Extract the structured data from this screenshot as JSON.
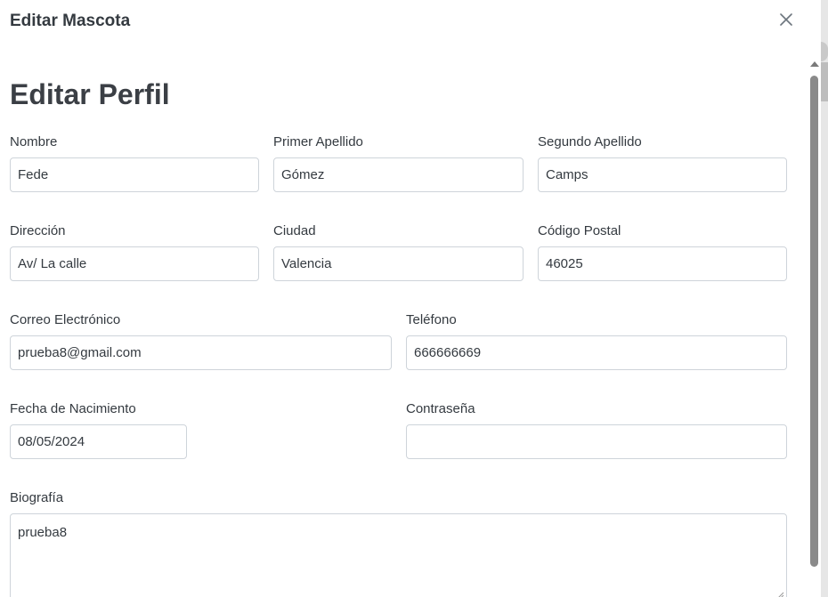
{
  "modal": {
    "title": "Editar Mascota"
  },
  "page": {
    "heading": "Editar Perfil"
  },
  "form": {
    "nombre": {
      "label": "Nombre",
      "value": "Fede"
    },
    "primer_apellido": {
      "label": "Primer Apellido",
      "value": "Gómez"
    },
    "segundo_apellido": {
      "label": "Segundo Apellido",
      "value": "Camps"
    },
    "direccion": {
      "label": "Dirección",
      "value": "Av/ La calle"
    },
    "ciudad": {
      "label": "Ciudad",
      "value": "Valencia"
    },
    "codigo_postal": {
      "label": "Código Postal",
      "value": "46025"
    },
    "correo": {
      "label": "Correo Electrónico",
      "value": "prueba8@gmail.com"
    },
    "telefono": {
      "label": "Teléfono",
      "value": "666666669"
    },
    "fecha_nacimiento": {
      "label": "Fecha de Nacimiento",
      "value": "08/05/2024"
    },
    "contrasena": {
      "label": "Contraseña",
      "value": ""
    },
    "biografia": {
      "label": "Biografía",
      "value": "prueba8"
    }
  },
  "icons": {
    "close": "close-icon"
  },
  "colors": {
    "text": "#343a40",
    "border": "#ced4da",
    "scroll_thumb": "#8a8a8a"
  }
}
